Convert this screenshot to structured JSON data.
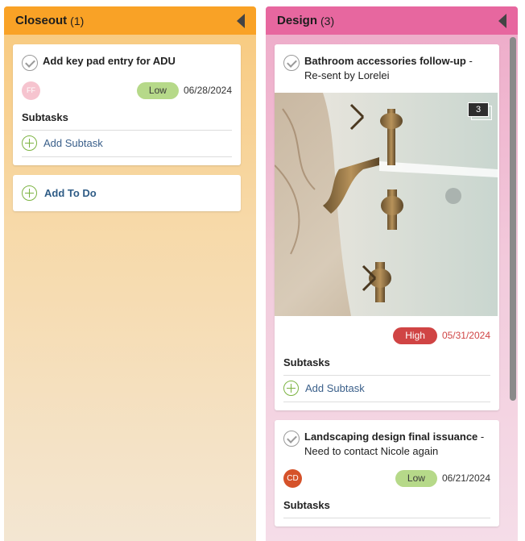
{
  "columns": [
    {
      "title": "Closeout",
      "count": "(1)",
      "color": "#f9a226",
      "cards": [
        {
          "title": "Add key pad entry for ADU",
          "avatar": "FF",
          "priority": "Low",
          "due": "06/28/2024",
          "subtasks_label": "Subtasks",
          "add_subtask_label": "Add Subtask"
        }
      ],
      "add_todo_label": "Add To Do"
    },
    {
      "title": "Design",
      "count": "(3)",
      "color": "#e7679f",
      "cards": [
        {
          "title": "Bathroom accessories follow-up",
          "note": " - Re-sent by Lorelei",
          "image_count": "3",
          "priority": "High",
          "due": "05/31/2024",
          "subtasks_label": "Subtasks",
          "add_subtask_label": "Add Subtask"
        },
        {
          "title": "Landscaping design final issuance",
          "note": " - Need to contact Nicole again",
          "avatar": "CD",
          "priority": "Low",
          "due": "06/21/2024",
          "subtasks_label": "Subtasks"
        }
      ]
    }
  ]
}
